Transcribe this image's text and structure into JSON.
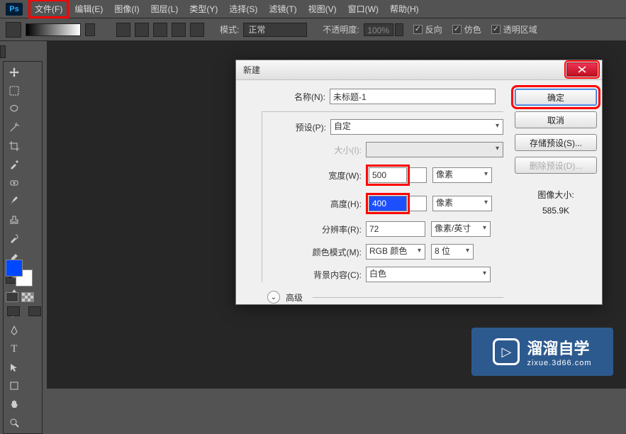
{
  "menubar": {
    "items": [
      "文件(F)",
      "编辑(E)",
      "图像(I)",
      "图层(L)",
      "类型(Y)",
      "选择(S)",
      "滤镜(T)",
      "视图(V)",
      "窗口(W)",
      "帮助(H)"
    ]
  },
  "optionsbar": {
    "mode_label": "模式:",
    "mode_value": "正常",
    "opacity_label": "不透明度:",
    "opacity_value": "100%",
    "reverse_label": "反向",
    "dither_label": "仿色",
    "transparency_label": "透明区域"
  },
  "dialog": {
    "title": "新建",
    "name_label": "名称(N):",
    "name_value": "未标题-1",
    "preset_label": "预设(P):",
    "preset_value": "自定",
    "size_label": "大小(I):",
    "width_label": "宽度(W):",
    "width_value": "500",
    "height_label": "高度(H):",
    "height_value": "400",
    "unit_px": "像素",
    "res_label": "分辨率(R):",
    "res_value": "72",
    "res_unit": "像素/英寸",
    "color_mode_label": "颜色模式(M):",
    "color_mode_value": "RGB 颜色",
    "bit_depth": "8 位",
    "bg_label": "背景内容(C):",
    "bg_value": "白色",
    "advanced_label": "高级",
    "ok_label": "确定",
    "cancel_label": "取消",
    "save_preset_label": "存储预设(S)...",
    "delete_preset_label": "删除预设(D)...",
    "image_size_label": "图像大小:",
    "image_size_value": "585.9K"
  },
  "watermark": {
    "main": "溜溜自学",
    "sub": "zixue.3d66.com"
  },
  "colors": {
    "highlight": "#ff0000",
    "fg": "#0048ff",
    "bg": "#ffffff"
  }
}
